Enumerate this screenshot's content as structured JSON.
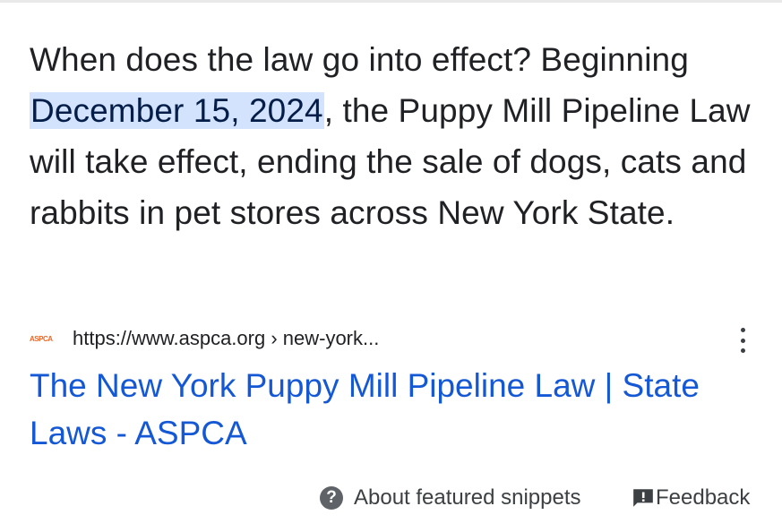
{
  "snippet": {
    "line_prefix": "When does the law go into effect? Beginning ",
    "highlight": "December 15, 2024",
    "line_suffix": ", the Puppy Mill Pipeline Law will take effect, ending the sale of dogs, cats and rabbits in pet stores across New York State."
  },
  "source": {
    "favicon_text": "ASPCA",
    "url": "https://www.aspca.org › new-york...",
    "more_icon": "vertical-dots-icon"
  },
  "result": {
    "title": "The New York Puppy Mill Pipeline Law | State Laws - ASPCA"
  },
  "footer": {
    "about_icon": "?",
    "about_label": "About featured snippets",
    "feedback_icon": "feedback-icon",
    "feedback_label": "Feedback"
  },
  "colors": {
    "highlight_bg": "#d3e3fd",
    "link": "#1558d6",
    "text": "#202124",
    "brand": "#f26522"
  }
}
